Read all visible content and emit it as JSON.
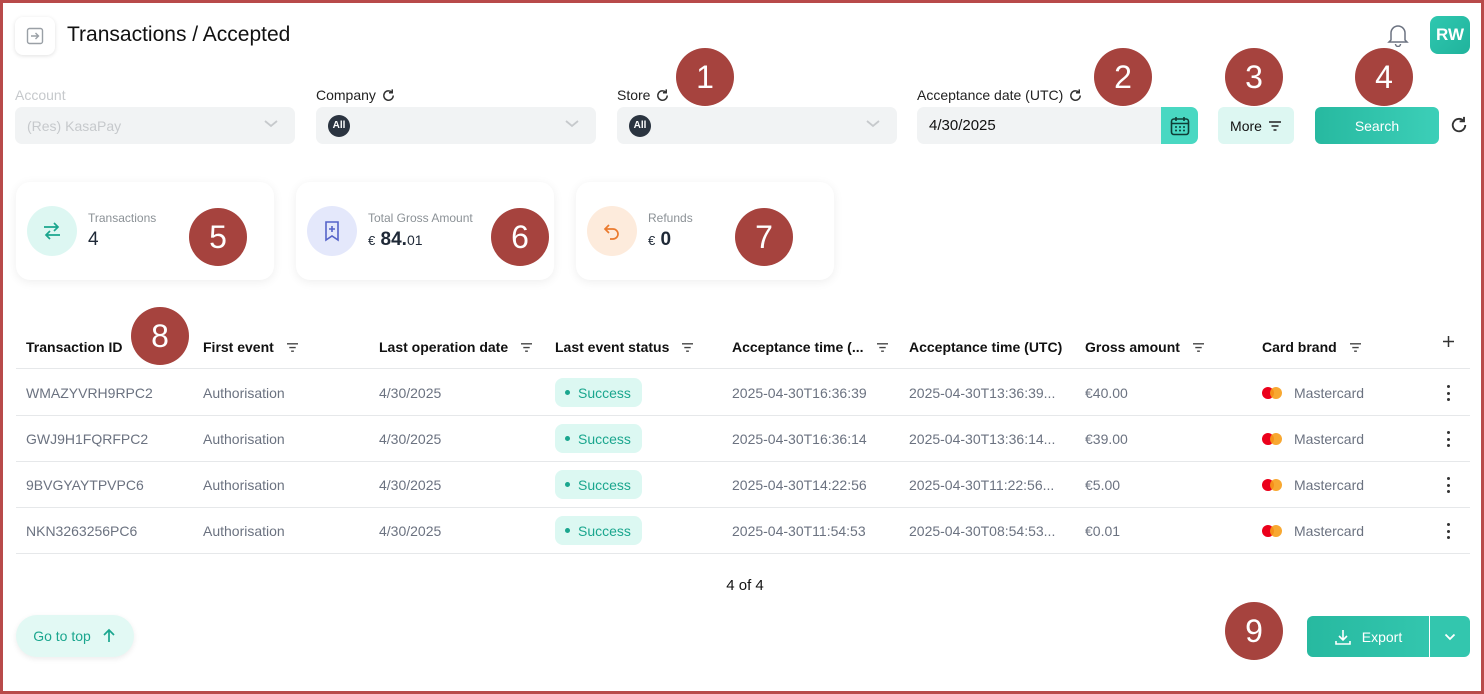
{
  "header": {
    "title": "Transactions / Accepted",
    "avatar_initials": "RW"
  },
  "filters": {
    "account": {
      "label": "Account",
      "value": "(Res) KasaPay"
    },
    "company": {
      "label": "Company",
      "chip": "All"
    },
    "store": {
      "label": "Store",
      "chip": "All"
    },
    "acceptance_date": {
      "label": "Acceptance date (UTC)",
      "value": "4/30/2025"
    },
    "more_label": "More",
    "search_label": "Search"
  },
  "callouts": [
    "1",
    "2",
    "3",
    "4",
    "5",
    "6",
    "7",
    "8",
    "9"
  ],
  "stats": {
    "transactions": {
      "label": "Transactions",
      "value": "4"
    },
    "gross": {
      "label": "Total Gross Amount",
      "currency": "€",
      "whole": "84.",
      "cents": "01"
    },
    "refunds": {
      "label": "Refunds",
      "currency": "€",
      "value": "0"
    }
  },
  "table": {
    "columns": [
      "Transaction ID",
      "First event",
      "Last operation date",
      "Last event status",
      "Acceptance time (...",
      "Acceptance time (UTC)",
      "Gross amount",
      "Card brand"
    ],
    "rows": [
      {
        "id": "WMAZYVRH9RPC2",
        "first_event": "Authorisation",
        "last_op": "4/30/2025",
        "status": "Success",
        "acc_local": "2025-04-30T16:36:39",
        "acc_utc": "2025-04-30T13:36:39...",
        "gross": "€40.00",
        "brand": "Mastercard"
      },
      {
        "id": "GWJ9H1FQRFPC2",
        "first_event": "Authorisation",
        "last_op": "4/30/2025",
        "status": "Success",
        "acc_local": "2025-04-30T16:36:14",
        "acc_utc": "2025-04-30T13:36:14...",
        "gross": "€39.00",
        "brand": "Mastercard"
      },
      {
        "id": "9BVGYAYTPVPC6",
        "first_event": "Authorisation",
        "last_op": "4/30/2025",
        "status": "Success",
        "acc_local": "2025-04-30T14:22:56",
        "acc_utc": "2025-04-30T11:22:56...",
        "gross": "€5.00",
        "brand": "Mastercard"
      },
      {
        "id": "NKN3263256PC6",
        "first_event": "Authorisation",
        "last_op": "4/30/2025",
        "status": "Success",
        "acc_local": "2025-04-30T11:54:53",
        "acc_utc": "2025-04-30T08:54:53...",
        "gross": "€0.01",
        "brand": "Mastercard"
      }
    ]
  },
  "pager": "4 of 4",
  "footer": {
    "go_top": "Go to top",
    "export": "Export"
  },
  "colors": {
    "accent": "#27b9a0",
    "callout": "#a6433e",
    "frame": "#b84a4a"
  }
}
